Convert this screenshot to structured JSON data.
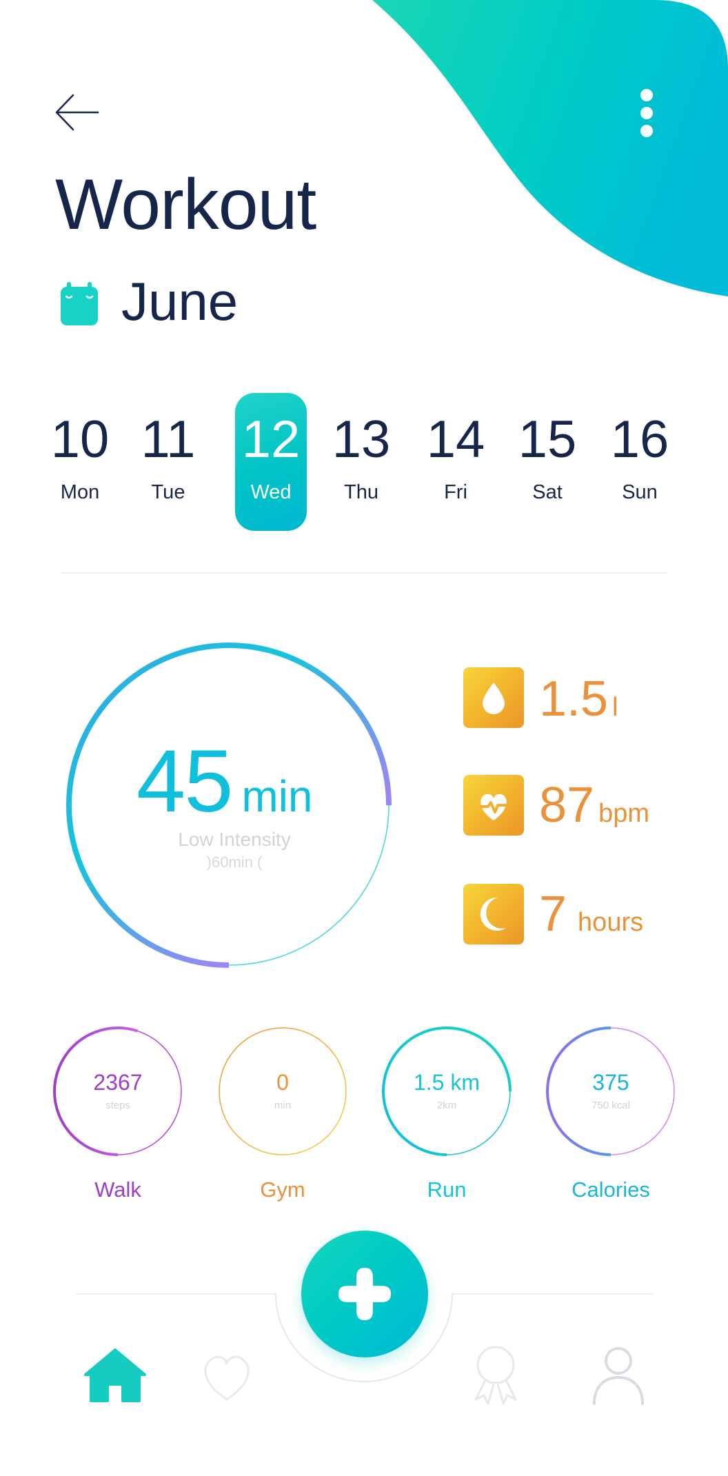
{
  "header": {
    "title": "Workout",
    "month": "June",
    "back_icon": "arrow-left-icon",
    "more_icon": "vertical-dots-icon",
    "calendar_icon": "calendar-icon"
  },
  "days": [
    {
      "num": "10",
      "dow": "Mon"
    },
    {
      "num": "11",
      "dow": "Tue"
    },
    {
      "num": "12",
      "dow": "Wed",
      "selected": true
    },
    {
      "num": "13",
      "dow": "Thu"
    },
    {
      "num": "14",
      "dow": "Fri"
    },
    {
      "num": "15",
      "dow": "Sat"
    },
    {
      "num": "16",
      "dow": "Sun"
    }
  ],
  "workout": {
    "value": "45",
    "unit": "min",
    "label": "Low Intensity",
    "sub": ")60min (",
    "progress": 0.75
  },
  "stats": [
    {
      "icon": "water-drop-icon",
      "value": "1.5",
      "unit": "l"
    },
    {
      "icon": "heart-rate-icon",
      "value": "87",
      "unit": "bpm"
    },
    {
      "icon": "moon-icon",
      "value": "7",
      "unit": "hours"
    }
  ],
  "activities": [
    {
      "key": "walk",
      "value": "2367",
      "sub": "steps",
      "label": "Walk",
      "color": "#9b3fc9",
      "progress": 0.55
    },
    {
      "key": "gym",
      "value": "0",
      "sub": "min",
      "label": "Gym",
      "color": "#e9923a",
      "progress": 0
    },
    {
      "key": "run",
      "value": "1.5 km",
      "sub": "2km",
      "label": "Run",
      "color": "#19c3cf",
      "progress": 0.75
    },
    {
      "key": "calories",
      "value": "375",
      "sub": "750 kcal",
      "label": "Calories",
      "color": "#17b6d8",
      "progress": 0.5
    }
  ],
  "nav": {
    "items": [
      "home-icon",
      "heart-icon",
      "badge-icon",
      "user-icon"
    ],
    "active": "home-icon",
    "fab_icon": "plus-icon"
  },
  "colors": {
    "navy": "#16264a",
    "teal": "#00c6c8",
    "orange": "#e9923a",
    "purple": "#9b3fc9",
    "magenta": "#e46ef2"
  }
}
